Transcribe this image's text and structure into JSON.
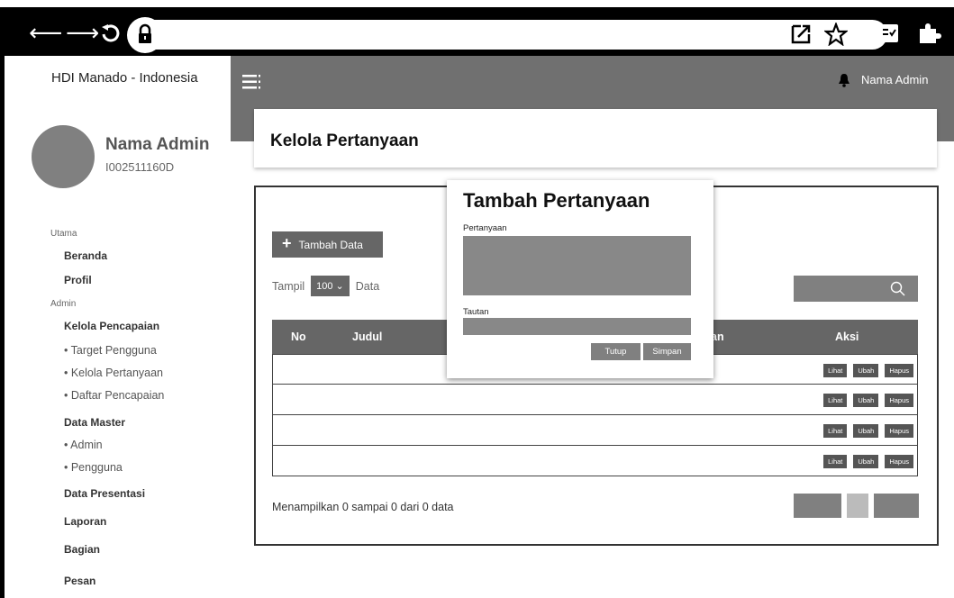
{
  "browser": {
    "icons": [
      "back-arrow-icon",
      "forward-arrow-icon",
      "reload-icon",
      "lock-icon",
      "external-link-icon",
      "star-icon",
      "reader-icon",
      "extension-icon"
    ]
  },
  "sidebar": {
    "brand": "HDI Manado - Indonesia",
    "profile": {
      "name": "Nama Admin",
      "id": "I002511160D"
    },
    "sections": {
      "utama": "Utama",
      "admin": "Admin"
    },
    "items": {
      "beranda": "Beranda",
      "profil": "Profil",
      "kelola_pencapaian": "Kelola Pencapaian",
      "target_pengguna": "• Target Pengguna",
      "kelola_pertanyaan": "• Kelola Pertanyaan",
      "daftar_pencapaian": "• Daftar Pencapaian",
      "data_master": "Data Master",
      "admin": "• Admin",
      "pengguna": "• Pengguna",
      "data_presentasi": "Data Presentasi",
      "laporan": "Laporan",
      "bagian": "Bagian",
      "pesan": "Pesan"
    }
  },
  "topbar": {
    "user": "Nama Admin"
  },
  "page": {
    "title": "Kelola Pertanyaan"
  },
  "toolbar": {
    "add_label": "Tambah Data",
    "show_label": "Tampil",
    "show_value": "100",
    "data_label": "Data"
  },
  "table": {
    "headers": {
      "no": "No",
      "judul": "Judul",
      "hidden": "an",
      "aksi": "Aksi"
    },
    "actions": {
      "view": "Lihat",
      "edit": "Ubah",
      "delete": "Hapus"
    },
    "rows": 4
  },
  "footer": {
    "info": "Menampilkan 0 sampai 0 dari 0 data"
  },
  "modal": {
    "title": "Tambah Pertanyaan",
    "question_label": "Pertanyaan",
    "link_label": "Tautan",
    "close_label": "Tutup",
    "save_label": "Simpan"
  },
  "colors": {
    "dark": "#000000",
    "gray_bar": "#707070",
    "button": "#666666",
    "field": "#888888"
  }
}
